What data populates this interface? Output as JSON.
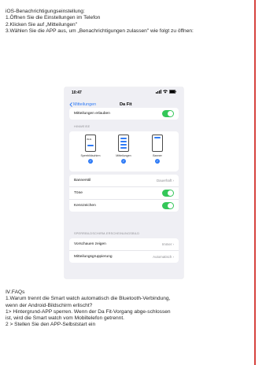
{
  "intro": {
    "heading": "iOS-Benachrichtigungseinstellung:",
    "step1": "1.Öffnen Sie die Einstellungen im Telefon",
    "step2": "2.Klicken Sie auf „Mitteilungen\"",
    "step3": "3.Wählen Sie die APP aus, um „Benachrichtigungen zulassen\" wie folgt zu öffnen:"
  },
  "phone": {
    "time": "10:47",
    "back_label": "Mitteilungen",
    "title": "Da Fit",
    "allow_label": "Mitteilungen erlauben",
    "allow_on": true,
    "section_alerts": "HINWEISE",
    "alert_options": [
      "Sperrbildschirm",
      "Mitteilungen",
      "Banner"
    ],
    "lock_time": "09:41",
    "banner_style_label": "Bannerstil",
    "banner_style_value": "Dauerhaft",
    "sounds_label": "Töne",
    "badges_label": "Kennzeichen",
    "section_lock": "SPERRBILDSCHIRM-ERSCHEINUNGSBILD",
    "preview_label": "Vorschauen zeigen",
    "preview_value": "Immer",
    "grouping_label": "Mitteilungsgruppierung",
    "grouping_value": "Automatisch",
    "accent_color": "#2f7bf6",
    "toggle_color": "#34c759"
  },
  "faq": {
    "heading": "Ⅳ.FAQs",
    "q1_line1": "1.Warum trennt die Smart watch automatisch die Bluetooth-Verbindung,",
    "q1_line2": "wenn der Android-Bildschirm erlischt?",
    "a1_line1": "1> Hintergrund-APP sperren. Wenn der Da Fit-Vorgang abge-schlossen",
    "a1_line2": "ist, wird die Smart watch vom Mobiltelefon getrennt.",
    "a2": "2 > Stellen Sie den APP-Selbststart ein"
  }
}
